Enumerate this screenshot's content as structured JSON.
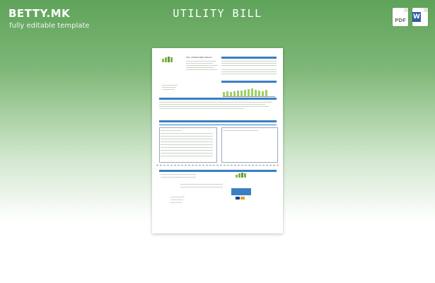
{
  "header": {
    "brand": "BETTY.MK",
    "tagline": "fully editable template",
    "title": "UTILITY BILL",
    "format_icons": [
      {
        "name": "pdf-icon",
        "label": "PDF"
      },
      {
        "name": "word-icon",
        "label": "W"
      }
    ]
  },
  "document": {
    "heading": "City of West Palm Beach"
  },
  "colors": {
    "accent_green": "#6aa95e",
    "doc_blue": "#3a7fc4"
  }
}
